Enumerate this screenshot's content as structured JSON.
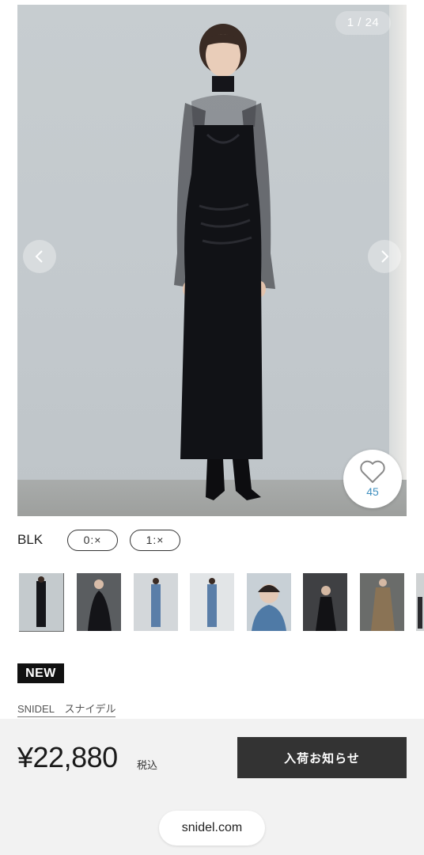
{
  "gallery": {
    "counter": "1 / 24",
    "prev_icon": "chevron-left-icon",
    "next_icon": "chevron-right-icon",
    "favorite": {
      "icon": "heart-icon",
      "count": "45"
    }
  },
  "variant": {
    "color": "BLK",
    "sizes": [
      "0:×",
      "1:×"
    ]
  },
  "thumbnails": [
    "thumb-1",
    "thumb-2",
    "thumb-3",
    "thumb-4",
    "thumb-5",
    "thumb-6",
    "thumb-7",
    "thumb-8"
  ],
  "product": {
    "badge": "NEW",
    "brand": "SNIDEL　スナイデル"
  },
  "purchase": {
    "price": "¥22,880",
    "tax_label": "税込",
    "notify_button": "入荷お知らせ"
  },
  "browser": {
    "url": "snidel.com"
  }
}
